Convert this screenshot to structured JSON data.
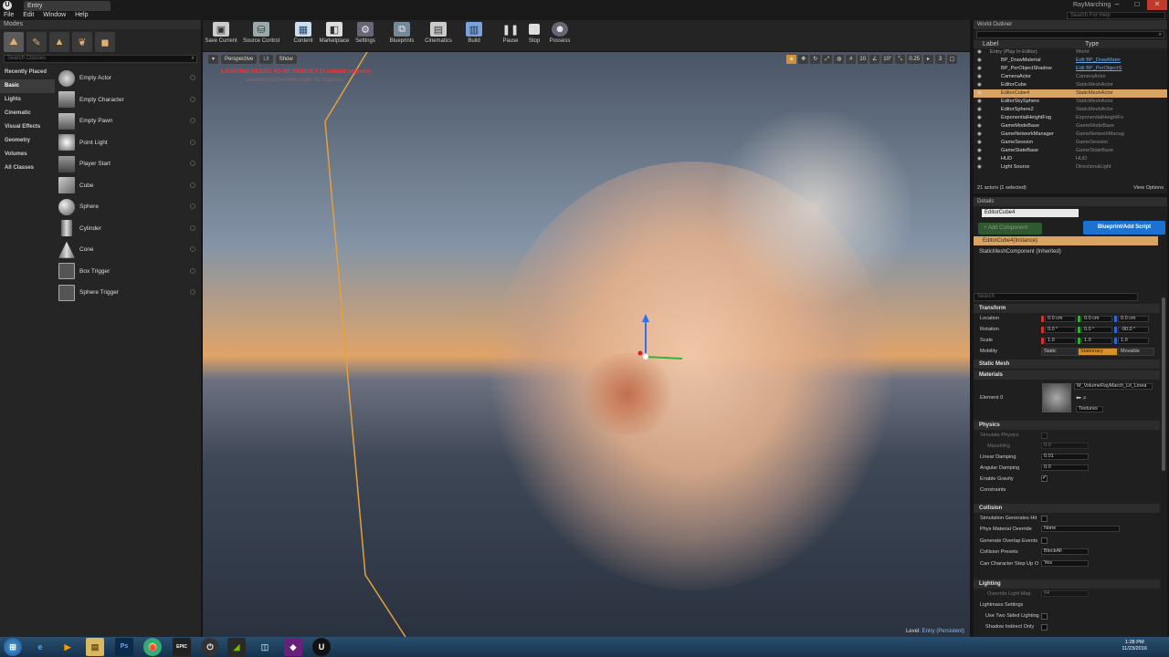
{
  "titlebar": {
    "tab": "Entry",
    "window_title": "RayMarching",
    "minimize": "–",
    "maximize": "□",
    "close": "✕"
  },
  "menu": {
    "items": [
      "File",
      "Edit",
      "Window",
      "Help"
    ],
    "search_placeholder": "Search For Help"
  },
  "modes": {
    "header": "Modes",
    "search_placeholder": "Search Classes",
    "categories": [
      "Recently Placed",
      "Basic",
      "Lights",
      "Cinematic",
      "Visual Effects",
      "Geometry",
      "Volumes",
      "All Classes"
    ],
    "selected_category": "Basic",
    "items": [
      "Empty Actor",
      "Empty Character",
      "Empty Pawn",
      "Point Light",
      "Player Start",
      "Cube",
      "Sphere",
      "Cylinder",
      "Cone",
      "Box Trigger",
      "Sphere Trigger"
    ]
  },
  "toolbar": {
    "buttons": [
      "Save Current",
      "Source Control",
      "Content",
      "Marketplace",
      "Settings",
      "Blueprints",
      "Cinematics",
      "Build",
      "Pause",
      "Stop",
      "Possess"
    ]
  },
  "viewport": {
    "perspective": "Perspective",
    "lit": "Lit",
    "show": "Show",
    "warning": "LIGHTING NEEDS TO BE REBUILT (3 unbuilt objects)",
    "warning_sub": "'DisableAllScreenMessages' to suppress",
    "grid_snap": "10",
    "rot_snap": "10°",
    "scale_snap": "0.25",
    "camera_speed": "3",
    "level_label": "Level:",
    "level_name": "Entry (Persistent)"
  },
  "outliner": {
    "header": "World Outliner",
    "col_label": "Label",
    "col_type": "Type",
    "rows": [
      {
        "name": "Entry (Play In Editor)",
        "type": "World"
      },
      {
        "name": "BP_DrawMaterial",
        "type": "Edit BP_DrawMater"
      },
      {
        "name": "BP_PerObjectShadow",
        "type": "Edit BP_PerObjectS"
      },
      {
        "name": "CameraActor",
        "type": "CameraActor"
      },
      {
        "name": "EditorCube",
        "type": "StaticMeshActor"
      },
      {
        "name": "EditorCube4",
        "type": "StaticMeshActor"
      },
      {
        "name": "EditorSkySphere",
        "type": "StaticMeshActor"
      },
      {
        "name": "EditorSphere2",
        "type": "StaticMeshActor"
      },
      {
        "name": "ExponentialHeightFog",
        "type": "ExponentialHeightFo"
      },
      {
        "name": "GameModeBase",
        "type": "GameModeBase"
      },
      {
        "name": "GameNetworkManager",
        "type": "GameNetworkManag"
      },
      {
        "name": "GameSession",
        "type": "GameSession"
      },
      {
        "name": "GameStateBase",
        "type": "GameStateBase"
      },
      {
        "name": "HUD",
        "type": "HUD"
      },
      {
        "name": "Light Source",
        "type": "DirectionalLight"
      }
    ],
    "selected_index": 5,
    "count": "21 actors (1 selected)",
    "view_options": "View Options"
  },
  "details": {
    "header": "Details",
    "object_name": "EditorCube4",
    "add_component": "+ Add Component",
    "blueprint": "Blueprint/Add Script",
    "instance": "EditorCube4(Instance)",
    "component": "StaticMeshComponent (Inherited)",
    "search_placeholder": "Search",
    "transform": {
      "title": "Transform",
      "location_label": "Location",
      "location": [
        "0.0 cm",
        "0.0 cm",
        "0.0 cm"
      ],
      "rotation_label": "Rotation",
      "rotation": [
        "0.0 °",
        "0.0 °",
        "-90.0 °"
      ],
      "scale_label": "Scale",
      "scale": [
        "1.0",
        "1.0",
        "1.0"
      ],
      "mobility_label": "Mobility",
      "mobility": [
        "Static",
        "Stationary",
        "Movable"
      ]
    },
    "static_mesh": "Static Mesh",
    "materials": {
      "title": "Materials",
      "element": "Element 0",
      "material": "M_VolumeRayMarch_Lit_Linea",
      "textures": "Textures"
    },
    "physics": {
      "title": "Physics",
      "simulate": "Simulate Physics",
      "mass_label": "MassInKg",
      "mass": "0.0",
      "linear_label": "Linear Damping",
      "linear": "0.01",
      "angular_label": "Angular Damping",
      "angular": "0.0",
      "gravity_label": "Enable Gravity",
      "constraints": "Constraints"
    },
    "collision": {
      "title": "Collision",
      "sim_hit": "Simulation Generates Hit",
      "phys_mat": "Phys Material Override",
      "phys_mat_value": "None",
      "overlap": "Generate Overlap Events",
      "presets_label": "Collision Presets",
      "presets": "BlockAll",
      "step_label": "Can Character Step Up O",
      "step": "Yes"
    },
    "lighting": {
      "title": "Lighting",
      "override": "Override Light Map",
      "override_value": "64",
      "lightmass": "Lightmass Settings",
      "two_sided": "Use Two Sided Lighting",
      "shadow": "Shadow Indirect Only"
    }
  },
  "taskbar": {
    "apps": [
      "⊞",
      "e",
      "▶",
      "▤",
      "Ps",
      "◉",
      "EPIC",
      "⏻",
      "◢",
      "◫",
      "◆",
      "U"
    ],
    "time": "1:28 PM",
    "date": "11/23/2016"
  },
  "colors": {
    "selection": "#d9a461",
    "accent_blue": "#1c72d0",
    "warning_red": "#ff3030",
    "panel": "#1f1f1f"
  }
}
